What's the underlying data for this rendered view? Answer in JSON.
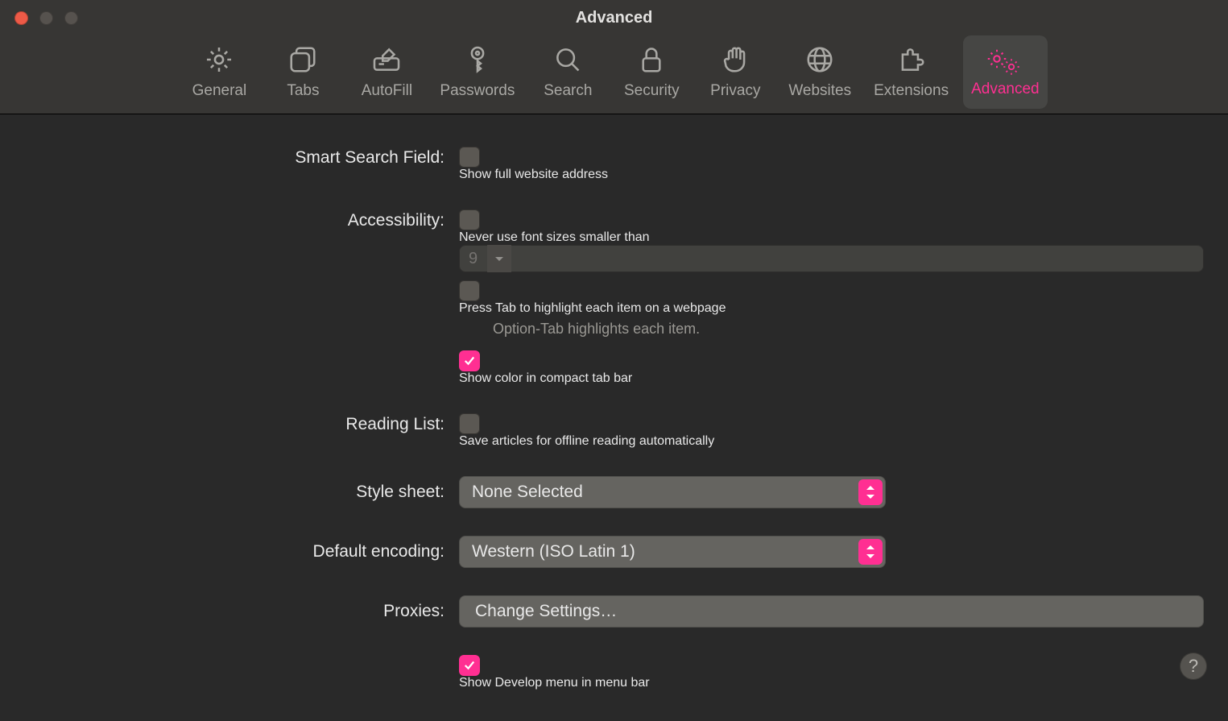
{
  "window": {
    "title": "Advanced"
  },
  "toolbar": {
    "items": [
      {
        "id": "general",
        "label": "General"
      },
      {
        "id": "tabs",
        "label": "Tabs"
      },
      {
        "id": "autofill",
        "label": "AutoFill"
      },
      {
        "id": "passwords",
        "label": "Passwords"
      },
      {
        "id": "search",
        "label": "Search"
      },
      {
        "id": "security",
        "label": "Security"
      },
      {
        "id": "privacy",
        "label": "Privacy"
      },
      {
        "id": "websites",
        "label": "Websites"
      },
      {
        "id": "extensions",
        "label": "Extensions"
      },
      {
        "id": "advanced",
        "label": "Advanced",
        "active": true
      }
    ]
  },
  "sections": {
    "smartSearch": {
      "label": "Smart Search Field:",
      "showFullAddress": {
        "checked": false,
        "label": "Show full website address"
      }
    },
    "accessibility": {
      "label": "Accessibility:",
      "minFontSize": {
        "checked": false,
        "label": "Never use font sizes smaller than",
        "value": "9"
      },
      "pressTab": {
        "checked": false,
        "label": "Press Tab to highlight each item on a webpage",
        "hint": "Option-Tab highlights each item."
      },
      "compactColor": {
        "checked": true,
        "label": "Show color in compact tab bar"
      }
    },
    "readingList": {
      "label": "Reading List:",
      "saveOffline": {
        "checked": false,
        "label": "Save articles for offline reading automatically"
      }
    },
    "styleSheet": {
      "label": "Style sheet:",
      "value": "None Selected"
    },
    "encoding": {
      "label": "Default encoding:",
      "value": "Western (ISO Latin 1)"
    },
    "proxies": {
      "label": "Proxies:",
      "button": "Change Settings…"
    },
    "develop": {
      "showDevelop": {
        "checked": true,
        "label": "Show Develop menu in menu bar"
      }
    }
  },
  "help": "?"
}
